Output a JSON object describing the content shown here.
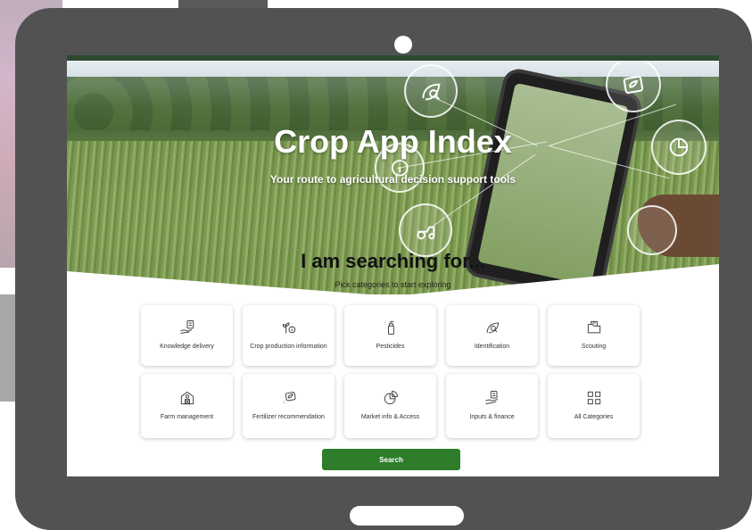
{
  "hero": {
    "title": "Crop App Index",
    "subtitle": "Your route to agricultural decision support tools"
  },
  "section": {
    "title": "I am searching for...",
    "subtitle": "Pick categories to start exploring"
  },
  "categories": [
    {
      "label": "Knowledge delivery",
      "icon": "hand-document-icon"
    },
    {
      "label": "Crop production information",
      "icon": "plant-info-icon"
    },
    {
      "label": "Pesticides",
      "icon": "spray-bottle-icon"
    },
    {
      "label": "Identification",
      "icon": "leaf-search-icon"
    },
    {
      "label": "Scouting",
      "icon": "folder-icon"
    },
    {
      "label": "Farm management",
      "icon": "barn-icon"
    },
    {
      "label": "Fertilizer recommendation",
      "icon": "soil-leaf-icon"
    },
    {
      "label": "Market info & Access",
      "icon": "pie-chart-icon"
    },
    {
      "label": "Inputs & finance",
      "icon": "hand-list-icon"
    },
    {
      "label": "All Categories",
      "icon": "grid-icon"
    }
  ],
  "search": {
    "label": "Search"
  },
  "colors": {
    "accent_green": "#2f7d2a",
    "topbar_green": "#2c4a2e",
    "tablet_frame": "#525252"
  }
}
